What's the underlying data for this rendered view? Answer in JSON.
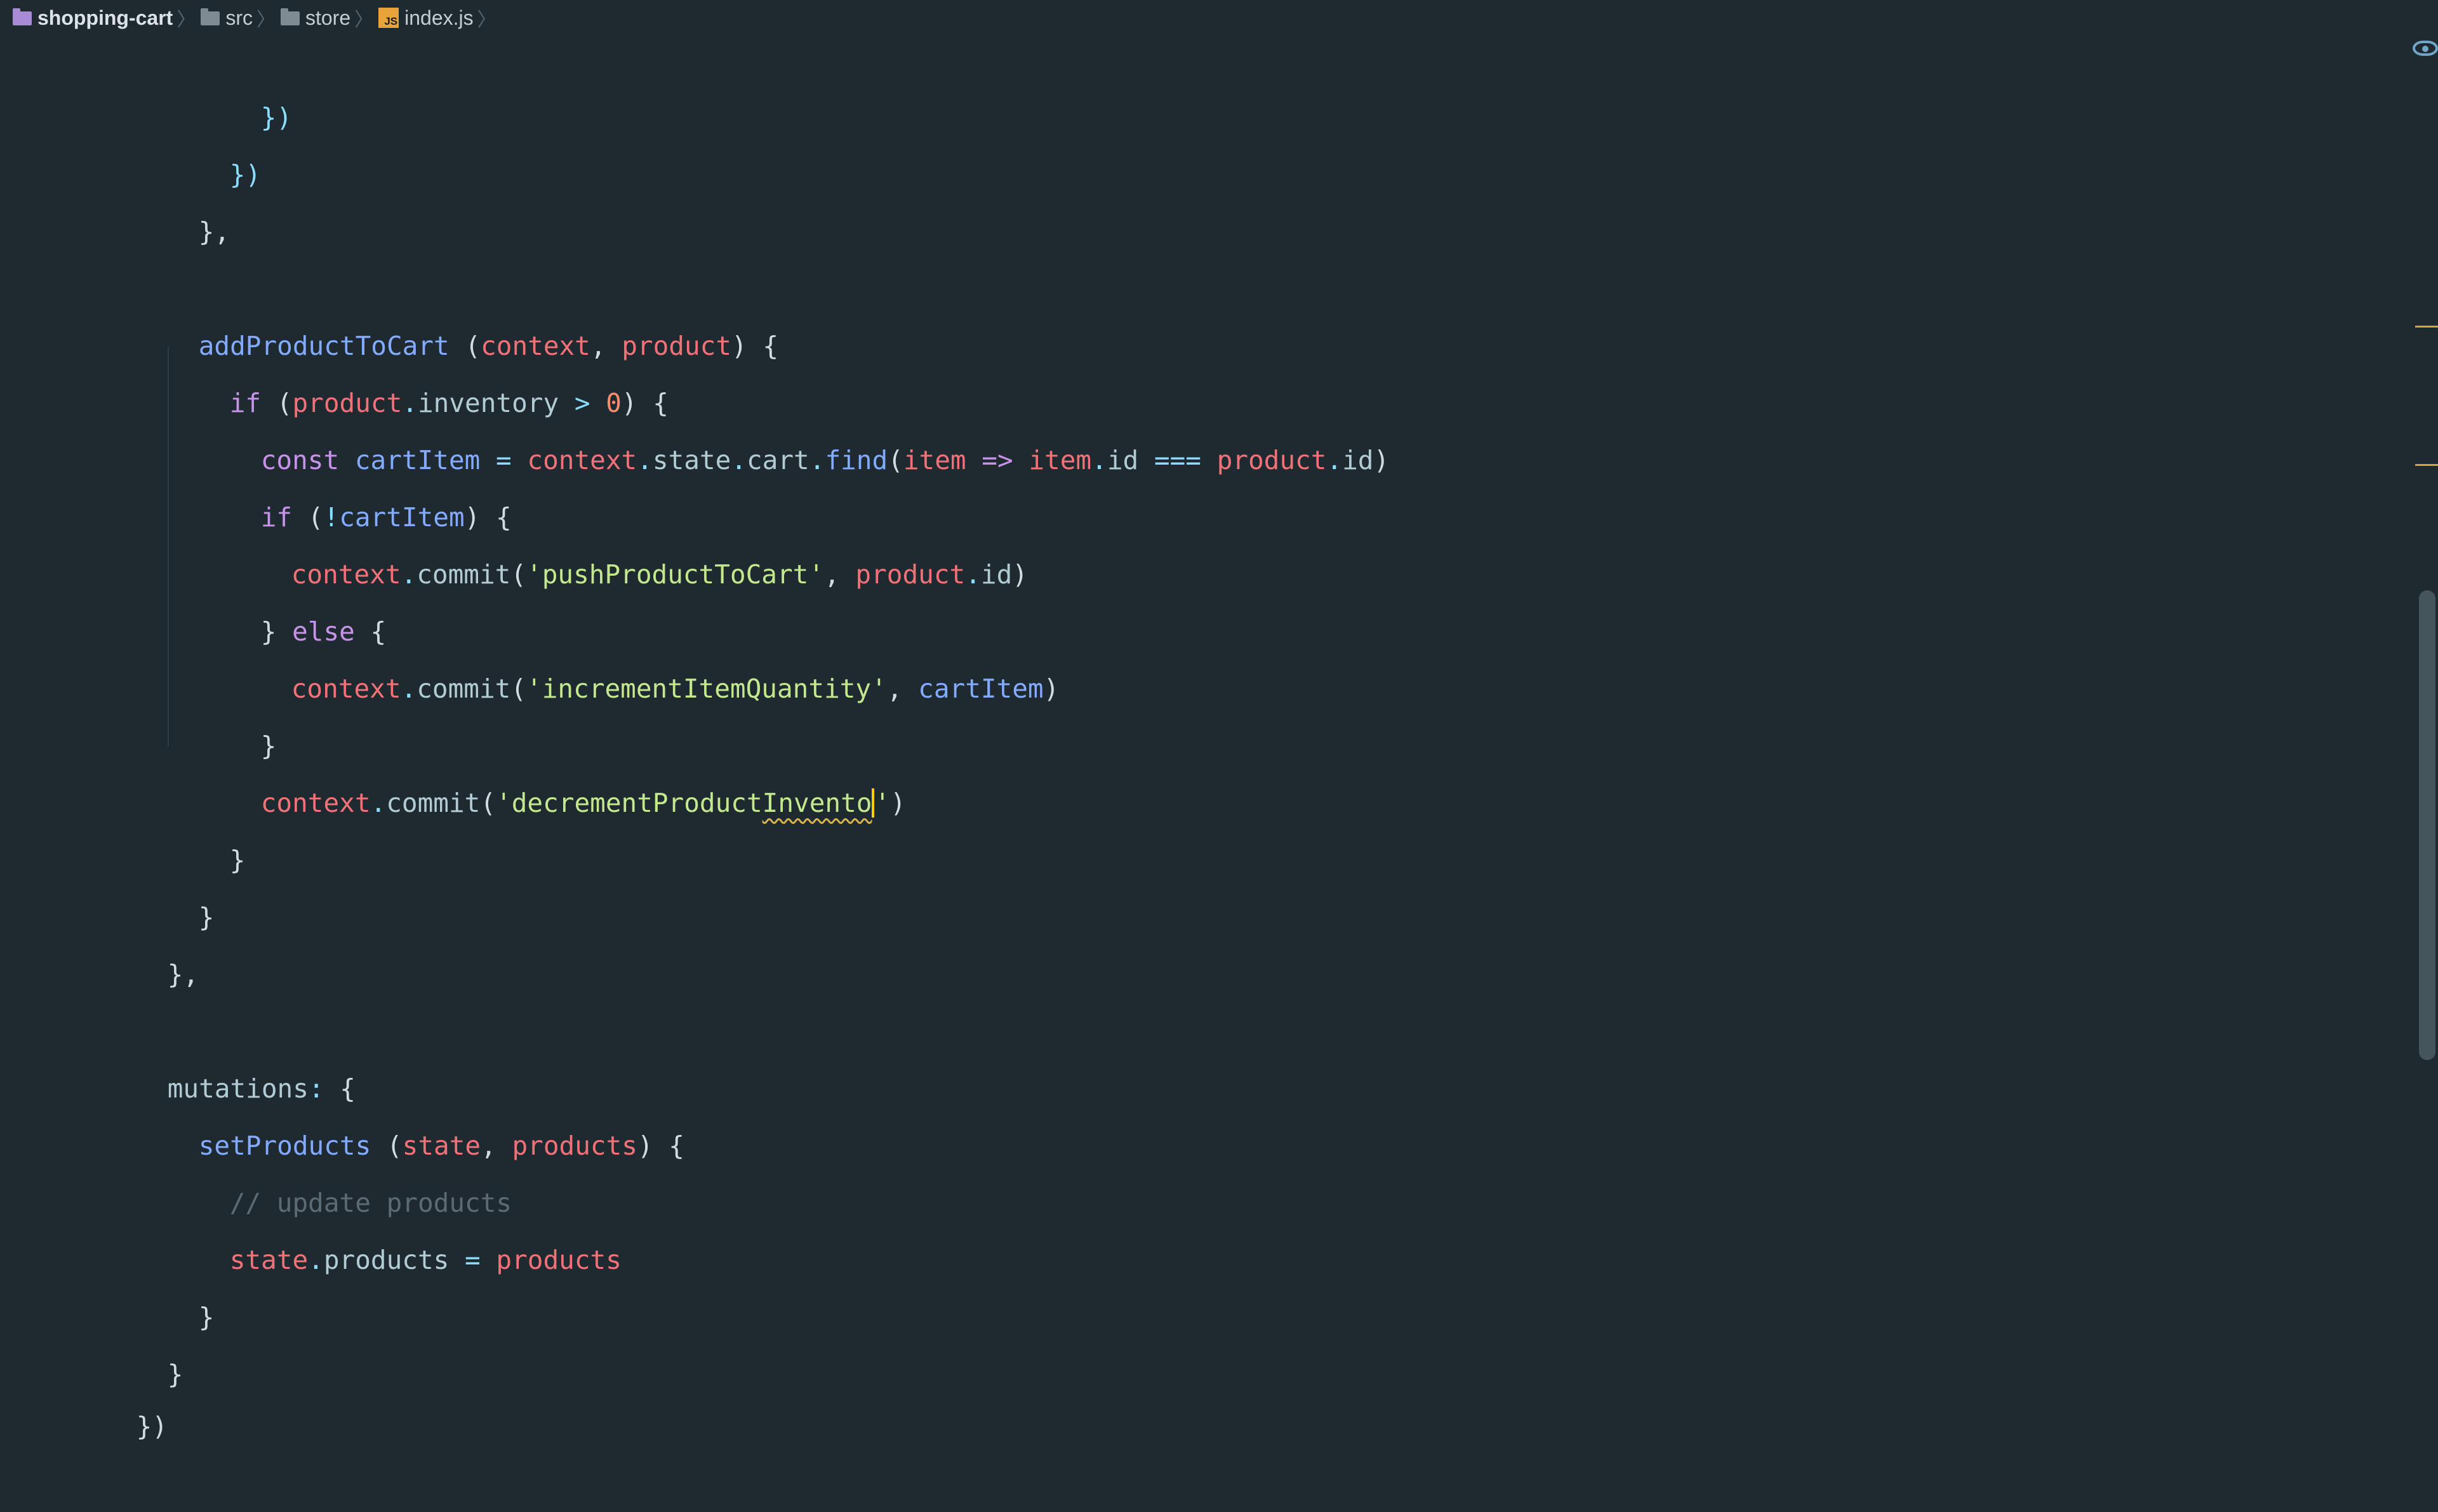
{
  "breadcrumb": {
    "project": "shopping-cart",
    "folder1": "src",
    "folder2": "store",
    "file": "index.js",
    "file_icon_label": "JS"
  },
  "code": {
    "l1": {
      "a": "})"
    },
    "l2": {
      "a": "})"
    },
    "l3": {
      "a": "},"
    },
    "l5": {
      "fn": "addProductToCart",
      "a": " (",
      "p1": "context",
      "b": ", ",
      "p2": "product",
      "c": ") {"
    },
    "l6": {
      "kw": "if",
      "a": " (",
      "p1": "product",
      "dot": ".",
      "prop": "inventory",
      "op": " > ",
      "num": "0",
      "b": ") {"
    },
    "l7": {
      "kw": "const",
      "v": " cartItem",
      "eq": " = ",
      "p1": "context",
      "d1": ".",
      "s1": "state",
      "d2": ".",
      "s2": "cart",
      "d3": ".",
      "fn": "find",
      "a": "(",
      "p2": "item",
      "arrow": " => ",
      "p3": "item",
      "d4": ".",
      "s3": "id",
      "cmp": " === ",
      "p4": "product",
      "d5": ".",
      "s4": "id",
      "b": ")"
    },
    "l8": {
      "kw": "if",
      "a": " (",
      "not": "!",
      "v": "cartItem",
      "b": ") {"
    },
    "l9": {
      "p1": "context",
      "d1": ".",
      "fn": "commit",
      "a": "(",
      "str": "'pushProductToCart'",
      "b": ", ",
      "p2": "product",
      "d2": ".",
      "s1": "id",
      "c": ")"
    },
    "l10": {
      "a": "} ",
      "kw": "else",
      "b": " {"
    },
    "l11": {
      "p1": "context",
      "d1": ".",
      "fn": "commit",
      "a": "(",
      "str": "'incrementItemQuantity'",
      "b": ", ",
      "v": "cartItem",
      "c": ")"
    },
    "l12": {
      "a": "}"
    },
    "l13": {
      "p1": "context",
      "d1": ".",
      "fn": "commit",
      "a": "(",
      "str1": "'decrementProduct",
      "typo": "Invento",
      "str2": "'",
      "c": ")"
    },
    "l14": {
      "a": "}"
    },
    "l15": {
      "a": "}"
    },
    "l16": {
      "a": "},"
    },
    "l18": {
      "prop": "mutations",
      "colon": ":",
      "a": " {"
    },
    "l19": {
      "fn": "setProducts",
      "a": " (",
      "p1": "state",
      "b": ", ",
      "p2": "products",
      "c": ") {"
    },
    "l20": {
      "cmt": "// update products"
    },
    "l21": {
      "p1": "state",
      "d1": ".",
      "prop": "products",
      "eq": " = ",
      "p2": "products"
    },
    "l22": {
      "a": "}"
    },
    "l23": {
      "a": "}"
    },
    "l24": {
      "a": "})"
    }
  }
}
